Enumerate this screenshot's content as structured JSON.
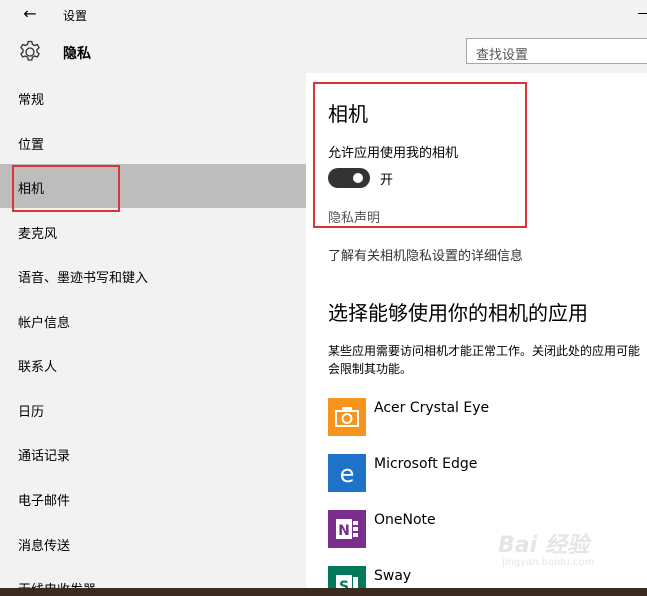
{
  "window": {
    "title": "设置"
  },
  "header": {
    "title": "隐私",
    "search_placeholder": "查找设置"
  },
  "sidebar": {
    "items": [
      {
        "label": "常规"
      },
      {
        "label": "位置"
      },
      {
        "label": "相机",
        "selected": true
      },
      {
        "label": "麦克风"
      },
      {
        "label": "语音、墨迹书写和键入"
      },
      {
        "label": "帐户信息"
      },
      {
        "label": "联系人"
      },
      {
        "label": "日历"
      },
      {
        "label": "通话记录"
      },
      {
        "label": "电子邮件"
      },
      {
        "label": "消息传送"
      },
      {
        "label": "无线电收发器"
      }
    ]
  },
  "content": {
    "section_title": "相机",
    "allow_label": "允许应用使用我的相机",
    "toggle_state": "开",
    "toggle_on": true,
    "privacy_link": "隐私声明",
    "learn_more_link": "了解有关相机隐私设置的详细信息",
    "apps_title": "选择能够使用你的相机的应用",
    "apps_description": "某些应用需要访问相机才能正常工作。关闭此处的应用可能会限制其功能。",
    "apps": [
      {
        "name": "Acer Crystal Eye",
        "icon": "camera-app-icon",
        "color": "#f7941d"
      },
      {
        "name": "Microsoft Edge",
        "icon": "edge-icon",
        "color": "#1e73c8"
      },
      {
        "name": "OneNote",
        "icon": "onenote-icon",
        "color": "#7a2f8c"
      },
      {
        "name": "Sway",
        "icon": "sway-icon",
        "color": "#007a5a"
      }
    ]
  },
  "watermark": {
    "text": "Bai 经验",
    "sub": "jingyan.baidu.com"
  },
  "colors": {
    "highlight": "#d9343a",
    "sidebar_bg": "#f2f2f2",
    "selected_bg": "#bdbdbd"
  }
}
